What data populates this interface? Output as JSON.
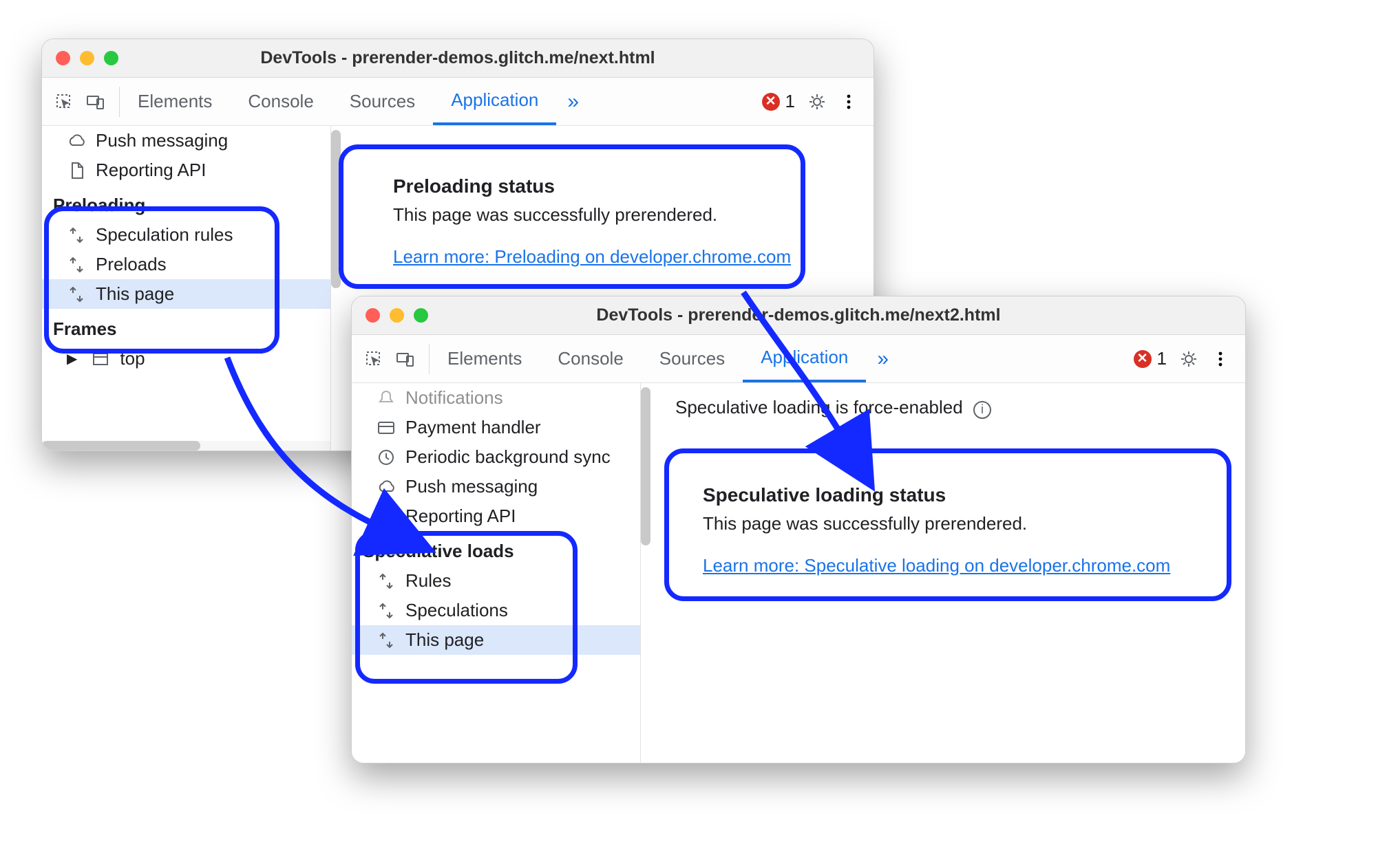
{
  "win1": {
    "title": "DevTools - prerender-demos.glitch.me/next.html",
    "tabs": {
      "elements": "Elements",
      "console": "Console",
      "sources": "Sources",
      "application": "Application",
      "expand": "»"
    },
    "errCount": "1",
    "sidebar": {
      "items_top": {
        "push": "Push messaging",
        "reporting": "Reporting API"
      },
      "preloading_section": "Preloading",
      "preloading": {
        "rules": "Speculation rules",
        "preloads": "Preloads",
        "thispage": "This page"
      },
      "frames_section": "Frames",
      "frames_top": "top"
    },
    "status": {
      "heading": "Preloading status",
      "body": "This page was successfully prerendered.",
      "link": "Learn more: Preloading on developer.chrome.com"
    }
  },
  "win2": {
    "title": "DevTools - prerender-demos.glitch.me/next2.html",
    "tabs": {
      "elements": "Elements",
      "console": "Console",
      "sources": "Sources",
      "application": "Application",
      "expand": "»"
    },
    "errCount": "1",
    "topNotice": "Speculative loading is force-enabled",
    "sidebar": {
      "items_top": {
        "notifications": "Notifications",
        "payment": "Payment handler",
        "periodic": "Periodic background sync",
        "push": "Push messaging",
        "reporting": "Reporting API"
      },
      "spec_section": "Speculative loads",
      "spec": {
        "rules": "Rules",
        "speculations": "Speculations",
        "thispage": "This page"
      }
    },
    "status": {
      "heading": "Speculative loading status",
      "body": "This page was successfully prerendered.",
      "link": "Learn more: Speculative loading on developer.chrome.com"
    }
  }
}
